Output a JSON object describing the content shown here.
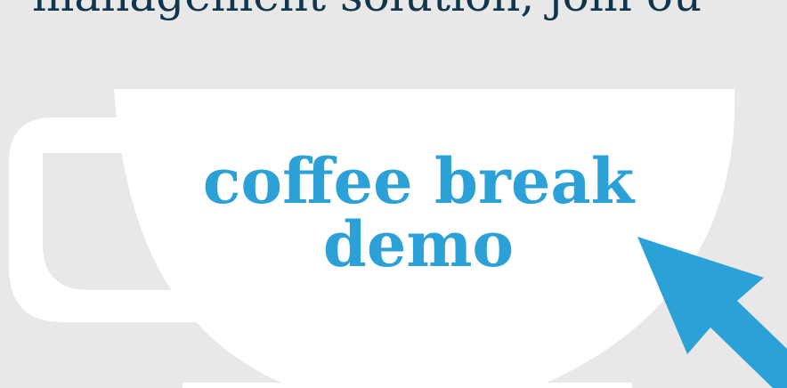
{
  "banner": {
    "headline": "management solution, join ou",
    "cup_text_line1": "coffee break",
    "cup_text_line2": "demo"
  },
  "colors": {
    "background": "#e8e8e8",
    "headline": "#12344d",
    "cup": "#ffffff",
    "accent": "#2ba1d8"
  },
  "icons": {
    "cup": "coffee-cup-icon",
    "cursor": "mouse-cursor-icon"
  }
}
